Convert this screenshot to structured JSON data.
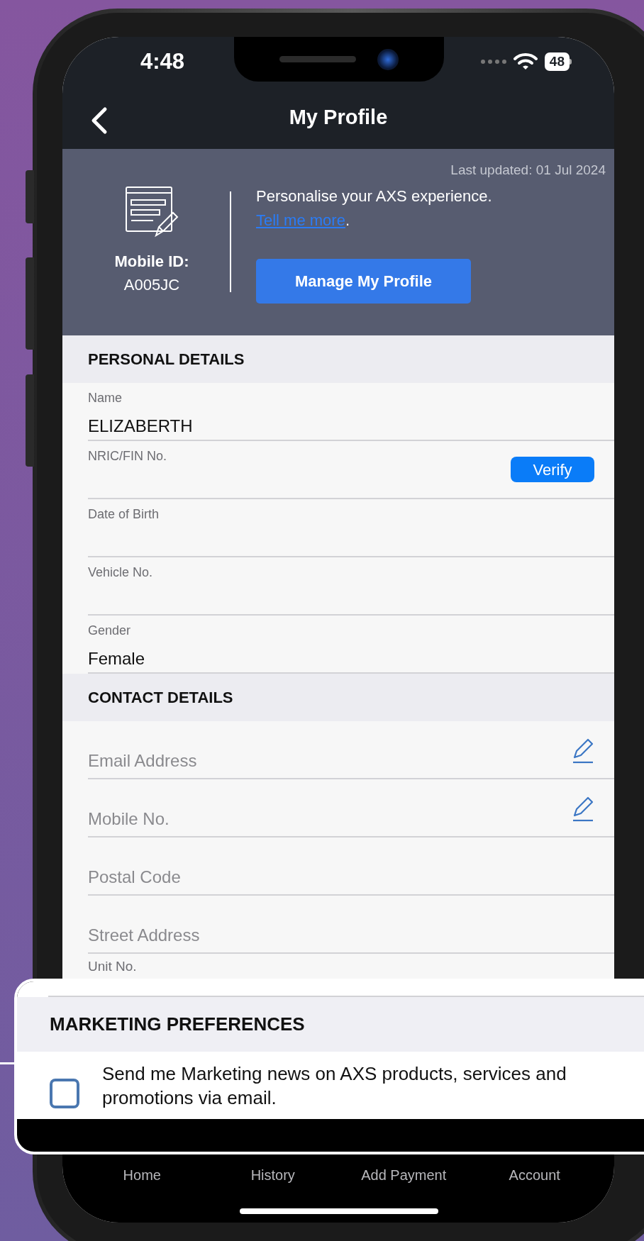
{
  "status_bar": {
    "time": "4:48",
    "battery": "48"
  },
  "nav": {
    "title": "My Profile"
  },
  "banner": {
    "last_updated": "Last updated: 01 Jul 2024",
    "id_label": "Mobile ID:",
    "id_value": "A005JC",
    "tagline": "Personalise your AXS experience.",
    "link": "Tell me more",
    "link_suffix": ".",
    "button": "Manage My Profile"
  },
  "sections": [
    {
      "title": "PERSONAL DETAILS",
      "fields": [
        {
          "kind": "labeled",
          "label": "Name",
          "value": "ELIZABERTH"
        },
        {
          "kind": "labeled",
          "label": "NRIC/FIN No.",
          "action": "Verify"
        },
        {
          "kind": "labeled",
          "label": "Date of Birth"
        },
        {
          "kind": "labeled",
          "label": "Vehicle No."
        },
        {
          "kind": "labeled",
          "label": "Gender",
          "value": "Female"
        }
      ]
    },
    {
      "title": "CONTACT DETAILS",
      "fields": [
        {
          "kind": "placeholder",
          "placeholder": "Email Address",
          "editable": true
        },
        {
          "kind": "placeholder",
          "placeholder": "Mobile No.",
          "editable": true
        },
        {
          "kind": "placeholder",
          "placeholder": "Postal Code",
          "editable": false
        },
        {
          "kind": "placeholder",
          "placeholder": "Street Address",
          "editable": false
        },
        {
          "kind": "partial",
          "label": "Unit No."
        }
      ]
    }
  ],
  "marketing": {
    "title": "MARKETING PREFERENCES",
    "option": {
      "label": "Send me Marketing news on AXS products, services and promotions via email.",
      "checked": false
    }
  },
  "tab_bar": [
    "Home",
    "History",
    "Add Payment",
    "Account"
  ]
}
